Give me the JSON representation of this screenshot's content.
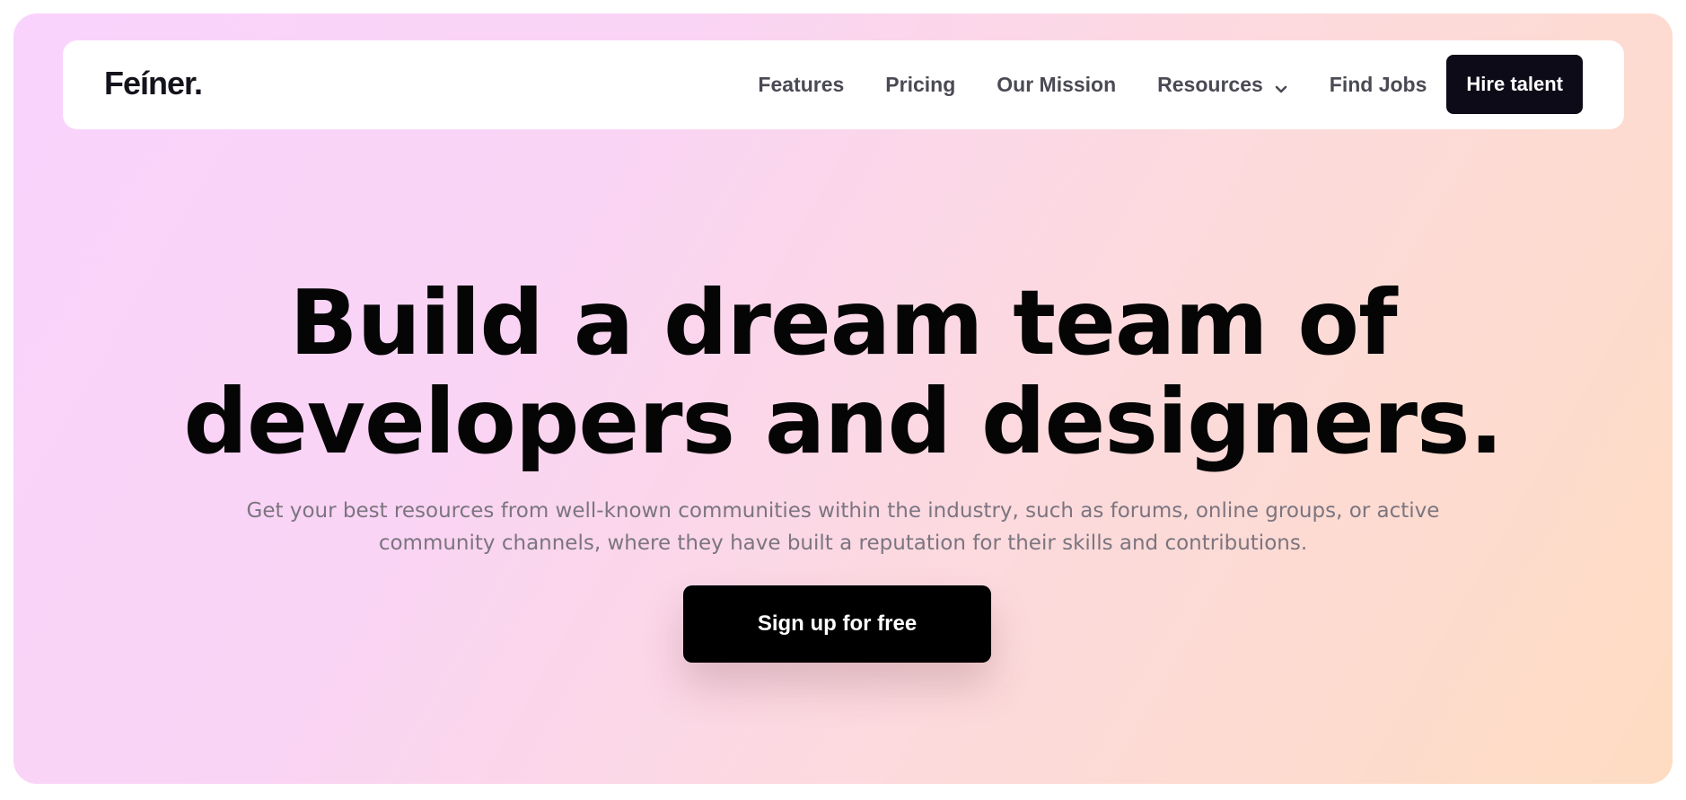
{
  "brand": {
    "logo_text": "Feíner."
  },
  "nav": {
    "items": [
      {
        "label": "Features"
      },
      {
        "label": "Pricing"
      },
      {
        "label": "Our Mission"
      },
      {
        "label": "Resources"
      },
      {
        "label": "Find Jobs"
      }
    ],
    "cta_label": "Hire talent",
    "resources_icon": "chevron-down-icon"
  },
  "hero": {
    "headline_line1": "Build a dream team of",
    "headline_line2": "developers and designers.",
    "subtitle": "Get your best resources from well-known communities within the industry, such as forums, online groups, or active community channels, where they have built a reputation for their skills and contributions.",
    "cta_label": "Sign up for free"
  },
  "colors": {
    "gradient_start": "#f9d3fc",
    "gradient_end": "#fedcc2",
    "primary_button": "#0d0b17",
    "nav_text": "#4a4a55",
    "subtitle_text": "#7b7580"
  }
}
